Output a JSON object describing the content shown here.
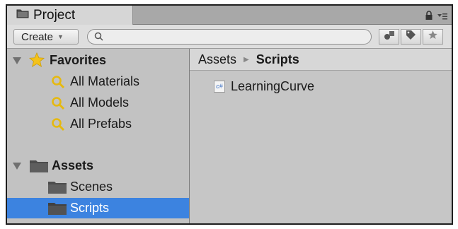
{
  "tab": {
    "label": "Project"
  },
  "toolbar": {
    "create_label": "Create",
    "search_placeholder": ""
  },
  "sidebar": {
    "favorites": {
      "label": "Favorites",
      "items": [
        {
          "label": "All Materials"
        },
        {
          "label": "All Models"
        },
        {
          "label": "All Prefabs"
        }
      ]
    },
    "assets": {
      "label": "Assets",
      "items": [
        {
          "label": "Scenes"
        },
        {
          "label": "Scripts"
        }
      ]
    }
  },
  "breadcrumb": {
    "root": "Assets",
    "current": "Scripts"
  },
  "files": [
    {
      "name": "LearningCurve",
      "icon_text": "c#"
    }
  ],
  "colors": {
    "selection": "#3c83e0",
    "favorite_star": "#f4c21a",
    "search_icon": "#e6b90f"
  }
}
